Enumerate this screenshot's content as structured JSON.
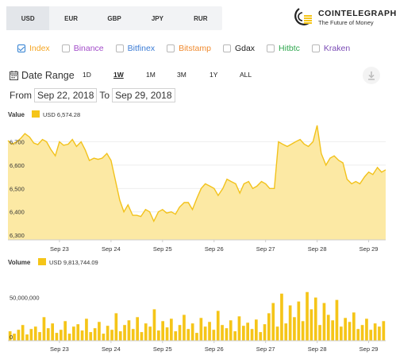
{
  "currency_tabs": [
    {
      "label": "USD",
      "active": true
    },
    {
      "label": "EUR",
      "active": false
    },
    {
      "label": "GBP",
      "active": false
    },
    {
      "label": "JPY",
      "active": false
    },
    {
      "label": "RUR",
      "active": false
    }
  ],
  "logo": {
    "name": "COINTELEGRAPH",
    "tagline": "The Future of Money"
  },
  "exchanges": [
    {
      "label": "Index",
      "checked": true,
      "color": "#f5a623"
    },
    {
      "label": "Binance",
      "checked": false,
      "color": "#a24bc9"
    },
    {
      "label": "Bitfinex",
      "checked": false,
      "color": "#3a7bd5"
    },
    {
      "label": "Bitstamp",
      "checked": false,
      "color": "#f08a2e"
    },
    {
      "label": "Gdax",
      "checked": false,
      "color": "#222222"
    },
    {
      "label": "Hitbtc",
      "checked": false,
      "color": "#2fa84f"
    },
    {
      "label": "Kraken",
      "checked": false,
      "color": "#7a4bb5"
    }
  ],
  "date_range": {
    "label": "Date Range",
    "buttons": [
      {
        "label": "1D",
        "active": false
      },
      {
        "label": "1W",
        "active": true
      },
      {
        "label": "1M",
        "active": false
      },
      {
        "label": "3M",
        "active": false
      },
      {
        "label": "1Y",
        "active": false
      },
      {
        "label": "ALL",
        "active": false
      }
    ],
    "from_label": "From",
    "from_value": "Sep 22, 2018",
    "to_label": "To",
    "to_value": "Sep 29, 2018"
  },
  "colors": {
    "accent": "#f5c518",
    "area_fill": "#fce9a4",
    "line": "#f2c21b",
    "bar": "#f5c518"
  },
  "chart_data": [
    {
      "type": "area",
      "title": "Value",
      "legend": "USD 6,574.28",
      "ylim": [
        6280,
        6780
      ],
      "y_ticks": [
        {
          "value": 6300,
          "label": "6,300"
        },
        {
          "value": 6400,
          "label": "6,400"
        },
        {
          "value": 6500,
          "label": "6,500"
        },
        {
          "value": 6600,
          "label": "6,600"
        },
        {
          "value": 6700,
          "label": "6,700"
        }
      ],
      "x_labels": [
        {
          "day": 1,
          "label": "Sep 23"
        },
        {
          "day": 2,
          "label": "Sep 24"
        },
        {
          "day": 3,
          "label": "Sep 25"
        },
        {
          "day": 4,
          "label": "Sep 26"
        },
        {
          "day": 5,
          "label": "Sep 27"
        },
        {
          "day": 6,
          "label": "Sep 28"
        },
        {
          "day": 7,
          "label": "Sep 29"
        }
      ],
      "xlim": [
        0.0,
        7.33
      ],
      "x": [
        0.0,
        0.08,
        0.17,
        0.25,
        0.33,
        0.42,
        0.5,
        0.58,
        0.67,
        0.75,
        0.83,
        0.92,
        1.0,
        1.08,
        1.17,
        1.25,
        1.33,
        1.42,
        1.5,
        1.58,
        1.67,
        1.75,
        1.83,
        1.92,
        2.0,
        2.08,
        2.17,
        2.25,
        2.33,
        2.42,
        2.5,
        2.58,
        2.67,
        2.75,
        2.83,
        2.92,
        3.0,
        3.08,
        3.17,
        3.25,
        3.33,
        3.42,
        3.5,
        3.58,
        3.67,
        3.75,
        3.83,
        3.92,
        4.0,
        4.08,
        4.17,
        4.25,
        4.33,
        4.42,
        4.5,
        4.58,
        4.67,
        4.75,
        4.83,
        4.92,
        5.0,
        5.08,
        5.17,
        5.25,
        5.33,
        5.42,
        5.5,
        5.58,
        5.67,
        5.75,
        5.83,
        5.92,
        6.0,
        6.08,
        6.17,
        6.25,
        6.33,
        6.42,
        6.5,
        6.58,
        6.67,
        6.75,
        6.83,
        6.92,
        7.0,
        7.08,
        7.17,
        7.25,
        7.33
      ],
      "y": [
        6705,
        6690,
        6700,
        6715,
        6735,
        6720,
        6695,
        6688,
        6710,
        6700,
        6668,
        6640,
        6700,
        6685,
        6690,
        6710,
        6680,
        6700,
        6665,
        6620,
        6630,
        6625,
        6630,
        6650,
        6620,
        6540,
        6450,
        6400,
        6430,
        6385,
        6385,
        6380,
        6410,
        6400,
        6360,
        6400,
        6410,
        6395,
        6400,
        6390,
        6420,
        6440,
        6440,
        6410,
        6460,
        6500,
        6520,
        6510,
        6500,
        6470,
        6500,
        6540,
        6530,
        6520,
        6480,
        6520,
        6530,
        6500,
        6510,
        6530,
        6520,
        6500,
        6500,
        6700,
        6690,
        6680,
        6690,
        6700,
        6710,
        6690,
        6680,
        6700,
        6770,
        6650,
        6600,
        6630,
        6640,
        6620,
        6610,
        6540,
        6520,
        6530,
        6520,
        6550,
        6570,
        6560,
        6590,
        6570,
        6580
      ]
    },
    {
      "type": "bar",
      "title": "Volume",
      "legend": "USD 9,813,744.09",
      "ylim": [
        0,
        90000000
      ],
      "y_ticks": [
        {
          "value": 0,
          "label": "0"
        },
        {
          "value": 50000000,
          "label": "50,000,000"
        }
      ],
      "x_labels": [
        {
          "day": 1,
          "label": "Sep 23"
        },
        {
          "day": 2,
          "label": "Sep 24"
        },
        {
          "day": 3,
          "label": "Sep 25"
        },
        {
          "day": 4,
          "label": "Sep 26"
        },
        {
          "day": 5,
          "label": "Sep 27"
        },
        {
          "day": 6,
          "label": "Sep 28"
        },
        {
          "day": 7,
          "label": "Sep 29"
        }
      ],
      "xlim": [
        0.0,
        7.33
      ],
      "values": [
        12000000,
        9000000,
        14000000,
        20000000,
        8000000,
        15000000,
        18000000,
        11000000,
        30000000,
        16000000,
        22000000,
        10000000,
        14000000,
        25000000,
        9000000,
        18000000,
        21000000,
        13000000,
        28000000,
        11000000,
        16000000,
        24000000,
        9000000,
        19000000,
        14000000,
        35000000,
        12000000,
        20000000,
        26000000,
        15000000,
        30000000,
        11000000,
        22000000,
        18000000,
        40000000,
        13000000,
        25000000,
        17000000,
        28000000,
        12000000,
        20000000,
        33000000,
        15000000,
        22000000,
        10000000,
        29000000,
        18000000,
        24000000,
        14000000,
        38000000,
        20000000,
        16000000,
        26000000,
        12000000,
        31000000,
        19000000,
        23000000,
        15000000,
        27000000,
        11000000,
        21000000,
        35000000,
        48000000,
        18000000,
        60000000,
        22000000,
        45000000,
        30000000,
        50000000,
        25000000,
        62000000,
        40000000,
        55000000,
        20000000,
        48000000,
        33000000,
        26000000,
        52000000,
        18000000,
        29000000,
        24000000,
        36000000,
        15000000,
        20000000,
        28000000,
        14000000,
        22000000,
        18000000,
        25000000
      ]
    }
  ]
}
